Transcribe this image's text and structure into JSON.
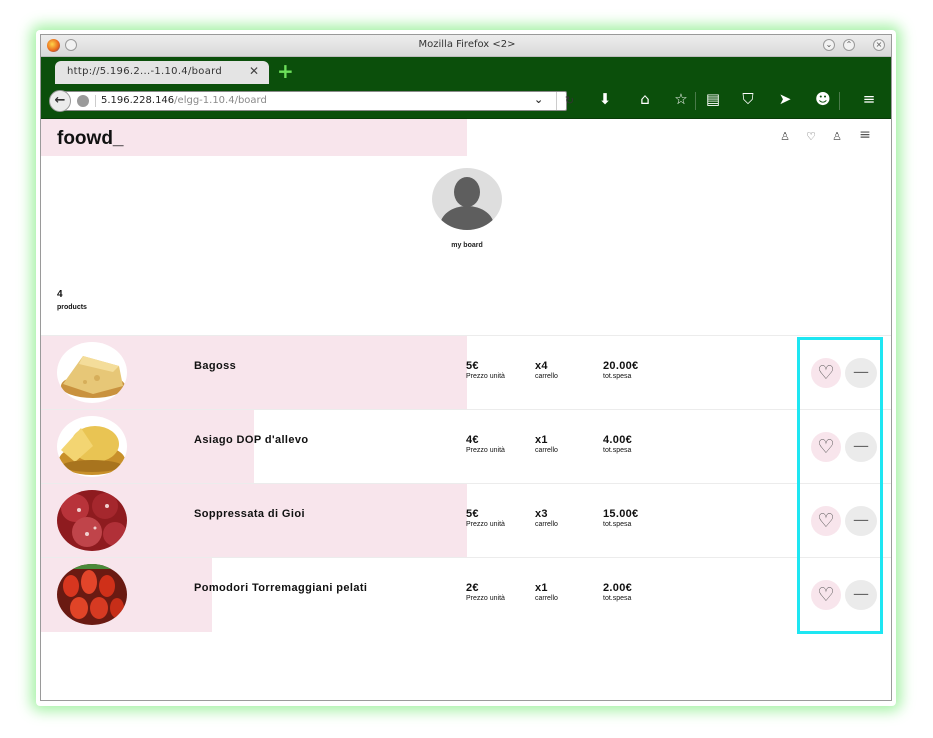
{
  "window": {
    "title": "Mozilla Firefox <2>"
  },
  "tab": {
    "title": "http://5.196.2...-1.10.4/board",
    "close": "✕",
    "new_tab": "+"
  },
  "url": {
    "host": "5.196.228.146",
    "path": "/elgg-1.10.4/board"
  },
  "site": {
    "logo": "foowd_",
    "header_icons": [
      "user-icon",
      "heart-icon",
      "user-icon",
      "menu-icon"
    ]
  },
  "profile": {
    "label": "my board"
  },
  "summary": {
    "count": "4",
    "label": "products"
  },
  "stat_labels": {
    "price": "Prezzo unità",
    "cart": "carrello",
    "total": "tot.spesa"
  },
  "products": [
    {
      "name": "Bagoss",
      "price": "5€",
      "qty": "x4",
      "total": "20.00€",
      "band_fill": 1.0
    },
    {
      "name": "Asiago DOP d'allevo",
      "price": "4€",
      "qty": "x1",
      "total": "4.00€",
      "band_fill": 0.6
    },
    {
      "name": "Soppressata di Gioi",
      "price": "5€",
      "qty": "x3",
      "total": "15.00€",
      "band_fill": 1.0
    },
    {
      "name": "Pomodori Torremaggiani pelati",
      "price": "2€",
      "qty": "x1",
      "total": "2.00€",
      "band_fill": 0.4
    }
  ],
  "colors": {
    "accent_pink": "#f8e5ec",
    "browser_green": "#0b4f0b",
    "highlight": "#1ee6f2",
    "glow": "#a6f2a6"
  }
}
